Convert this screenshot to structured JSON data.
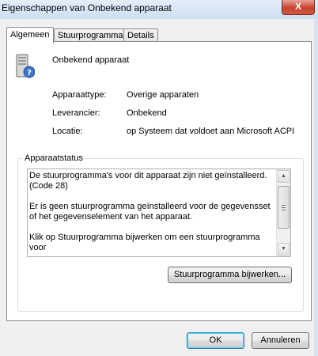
{
  "window": {
    "title": "Eigenschappen van Onbekend apparaat",
    "close_glyph": "X"
  },
  "tabs": [
    {
      "label": "Algemeen",
      "active": true
    },
    {
      "label": "Stuurprogramma",
      "active": false
    },
    {
      "label": "Details",
      "active": false
    }
  ],
  "device": {
    "icon": "unknown-device-icon",
    "name": "Onbekend apparaat",
    "rows": [
      {
        "label": "Apparaattype:",
        "value": "Overige apparaten"
      },
      {
        "label": "Leverancier:",
        "value": "Onbekend"
      },
      {
        "label": "Locatie:",
        "value": "op Systeem dat voldoet aan Microsoft ACPI"
      }
    ]
  },
  "status": {
    "group_label": "Apparaatstatus",
    "paragraphs": [
      "De stuurprogramma's voor dit apparaat zijn niet geïnstalleerd. (Code 28)",
      "Er is geen stuurprogramma geïnstalleerd voor de gegevensset of het gegevenselement van het apparaat.",
      "Klik op Stuurprogramma bijwerken om een stuurprogramma voor"
    ],
    "update_button": "Stuurprogramma bijwerken..."
  },
  "buttons": {
    "ok": "OK",
    "cancel": "Annuleren"
  }
}
